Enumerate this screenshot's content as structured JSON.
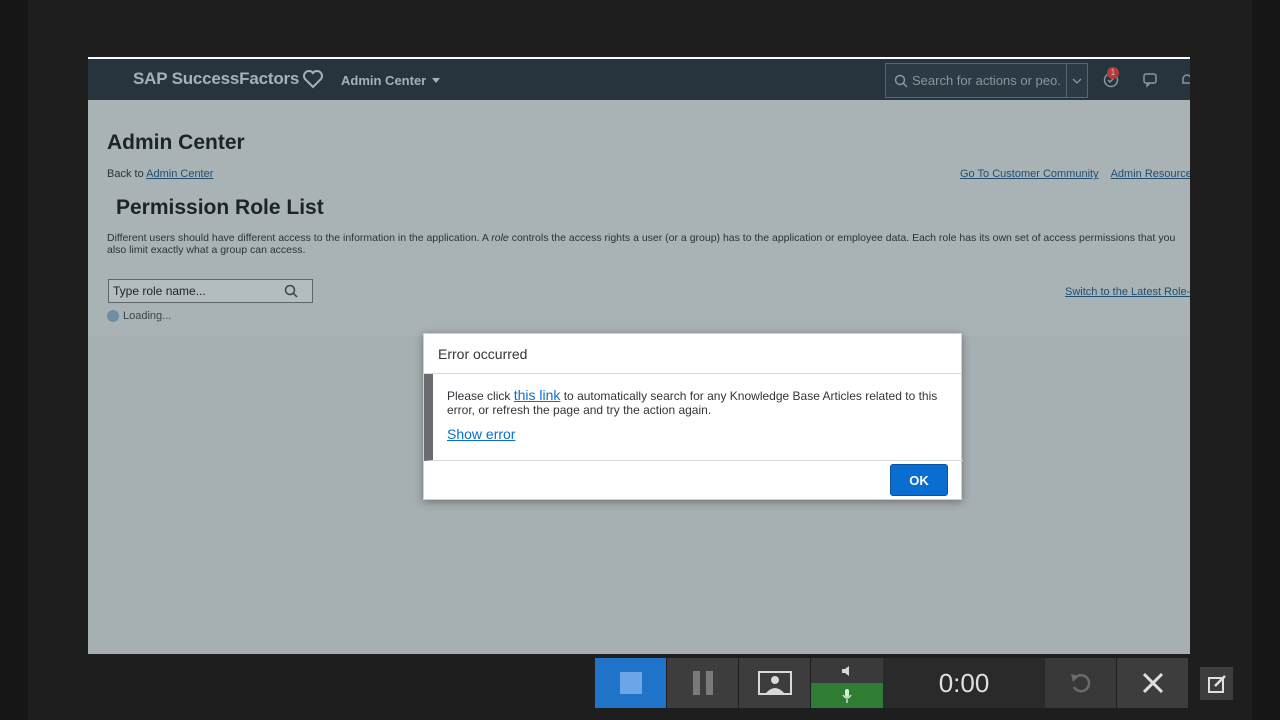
{
  "shell": {
    "brand": "SAP SuccessFactors",
    "module": "Admin Center",
    "search_placeholder": "Search for actions or peo...",
    "notification_count": "1"
  },
  "page": {
    "heading": "Admin Center",
    "back_prefix": "Back to",
    "back_link": "Admin Center",
    "top_links": [
      "Go To Customer Community",
      "Admin Resources"
    ],
    "title": "Permission Role List",
    "description_part1": "Different users should have different access to the information in the application. A ",
    "description_role": "role",
    "description_part2": " controls the access rights a user (or a group) has to the application or employee data. Each role has its own set of access permissions that you",
    "description_line2": "also limit exactly what a group can access.",
    "role_search_placeholder": "Type role name...",
    "switch_link": "Switch to the Latest Role-B",
    "loading": "Loading..."
  },
  "dialog": {
    "title": "Error occurred",
    "msg_prefix": "Please click ",
    "msg_link": "this link",
    "msg_suffix": " to automatically search for any Knowledge Base Articles related to this error, or refresh the page and try the action again.",
    "show_error": "Show error",
    "ok_label": "OK"
  },
  "recorder": {
    "timer": "0:00",
    "buttons": [
      "stop-icon",
      "pause-icon",
      "webcam-icon",
      "speaker-icon",
      "microphone-icon",
      "undo-icon",
      "close-icon",
      "edit-icon"
    ]
  }
}
